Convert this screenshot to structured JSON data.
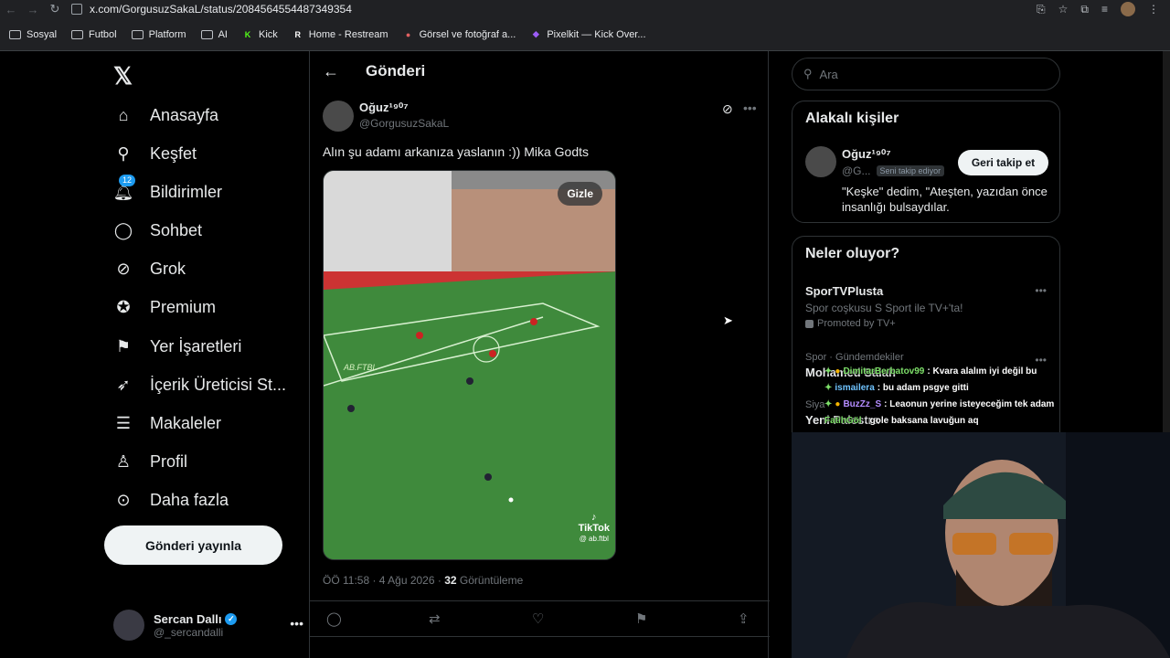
{
  "browser": {
    "url": "x.com/GorgusuzSakaL/status/2084564554487349354",
    "bookmarks": [
      {
        "label": "Sosyal",
        "kind": "folder"
      },
      {
        "label": "Futbol",
        "kind": "folder"
      },
      {
        "label": "Platform",
        "kind": "folder"
      },
      {
        "label": "AI",
        "kind": "folder"
      },
      {
        "label": "Kick",
        "kind": "site",
        "badge": "K",
        "color": "#53fc18"
      },
      {
        "label": "Home - Restream",
        "kind": "site",
        "badge": "R",
        "color": "#ffffff"
      },
      {
        "label": "Görsel ve fotoğraf a...",
        "kind": "site",
        "badge": "●",
        "color": "#e06060"
      },
      {
        "label": "Pixelkit — Kick Over...",
        "kind": "site",
        "badge": "◆",
        "color": "#9b5cf6"
      }
    ]
  },
  "nav": {
    "items": [
      {
        "label": "Anasayfa",
        "icon": "home-icon"
      },
      {
        "label": "Keşfet",
        "icon": "search-icon"
      },
      {
        "label": "Bildirimler",
        "icon": "bell-icon",
        "badge": "12"
      },
      {
        "label": "Sohbet",
        "icon": "chat-icon"
      },
      {
        "label": "Grok",
        "icon": "grok-icon"
      },
      {
        "label": "Premium",
        "icon": "premium-icon"
      },
      {
        "label": "Yer İşaretleri",
        "icon": "bookmark-icon"
      },
      {
        "label": "İçerik Üreticisi St...",
        "icon": "rocket-icon"
      },
      {
        "label": "Makaleler",
        "icon": "article-icon"
      },
      {
        "label": "Profil",
        "icon": "profile-icon"
      },
      {
        "label": "Daha fazla",
        "icon": "more-circle-icon"
      }
    ],
    "post_button": "Gönderi yayınla",
    "account": {
      "name": "Sercan Dallı",
      "handle": "@_sercandalli"
    }
  },
  "main": {
    "title": "Gönderi",
    "post": {
      "author_name": "Oğuz¹⁹⁰⁷",
      "author_handle": "@GorgusuzSakaL",
      "text": "Alın şu adamı arkanıza yaslanın :)) Mika Godts",
      "media": {
        "hide_label": "Gizle",
        "tiktok_label": "TikTok",
        "tiktok_handle": "@ ab.ftbl",
        "watermark": "AB.FTBL"
      },
      "time": "ÖÖ 11:58 · 4 Ağu 2026 · ",
      "views_count": "32",
      "views_label": " Görüntüleme"
    }
  },
  "right": {
    "search_placeholder": "Ara",
    "related": {
      "title": "Alakalı kişiler",
      "name": "Oğuz¹⁹⁰⁷",
      "handle": "@G...",
      "follows_you": "Seni takip ediyor",
      "button": "Geri takip et",
      "bio": "\"Keşke\" dedim, \"Ateşten, yazıdan önce insanlığı bulsaydılar."
    },
    "trends": {
      "title": "Neler oluyor?",
      "promo": {
        "title": "SporTVPlusta",
        "subtitle": "Spor coşkusu S Sport ile TV+'ta!",
        "promoted": "Promoted by TV+"
      },
      "items": [
        {
          "category": "Spor · Gündemdekiler",
          "name": "Mohamed Salah"
        },
        {
          "category": "Siya",
          "name": "Yeni Palestra"
        }
      ]
    }
  },
  "chat": [
    {
      "user": "DimitarBerbatov99",
      "user_color": "#7ee06a",
      "msg": ": Kvara alalım iyi değil bu",
      "badges": [
        "sparkle",
        "coin"
      ]
    },
    {
      "user": "ismailera",
      "user_color": "#6fc3ff",
      "msg": ": bu adam psgye gitti",
      "badges": [
        "sparkle"
      ]
    },
    {
      "user": "BuzZz_S",
      "user_color": "#b48cff",
      "msg": ": Leaonun yerine isteyeceğim tek adam",
      "badges": [
        "sparkle",
        "coin"
      ]
    },
    {
      "user": "FatihGöl",
      "user_color": "#7ee06a",
      "msg": ": gole baksana lavuğun aq",
      "badges": []
    }
  ],
  "colors": {
    "accent": "#1d9bf0",
    "background": "#000000",
    "border": "#2f3336"
  }
}
